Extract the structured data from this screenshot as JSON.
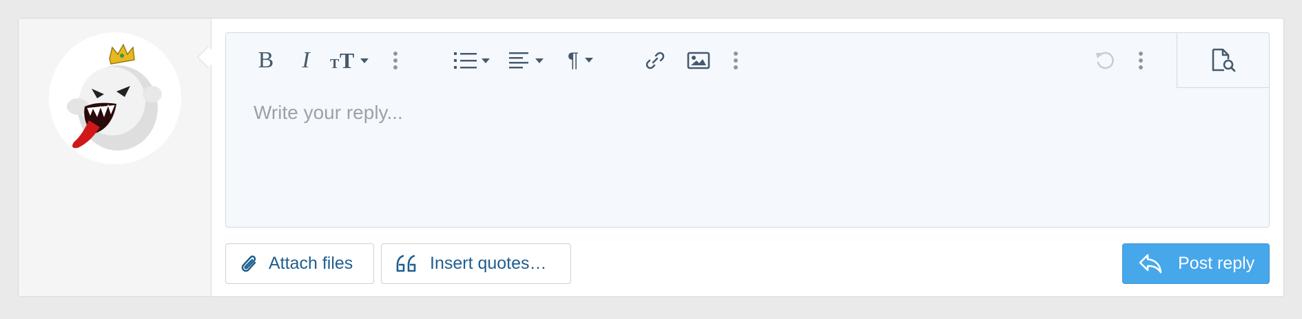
{
  "editor": {
    "placeholder": "Write your reply..."
  },
  "toolbar": {
    "bold": "B",
    "italic": "I",
    "paragraph": "¶",
    "icons": [
      "bold-icon",
      "italic-icon",
      "text-size-icon",
      "more-icon",
      "list-icon",
      "align-icon",
      "paragraph-icon",
      "link-icon",
      "image-icon",
      "more-icon",
      "undo-icon",
      "more-icon",
      "preview-icon"
    ]
  },
  "actions": {
    "attach_label": "Attach files",
    "quotes_label": "Insert quotes…",
    "post_label": "Post reply"
  },
  "colors": {
    "accent": "#47a7eb",
    "link": "#1f5e8e",
    "editor_bg": "#f5f9fd"
  }
}
